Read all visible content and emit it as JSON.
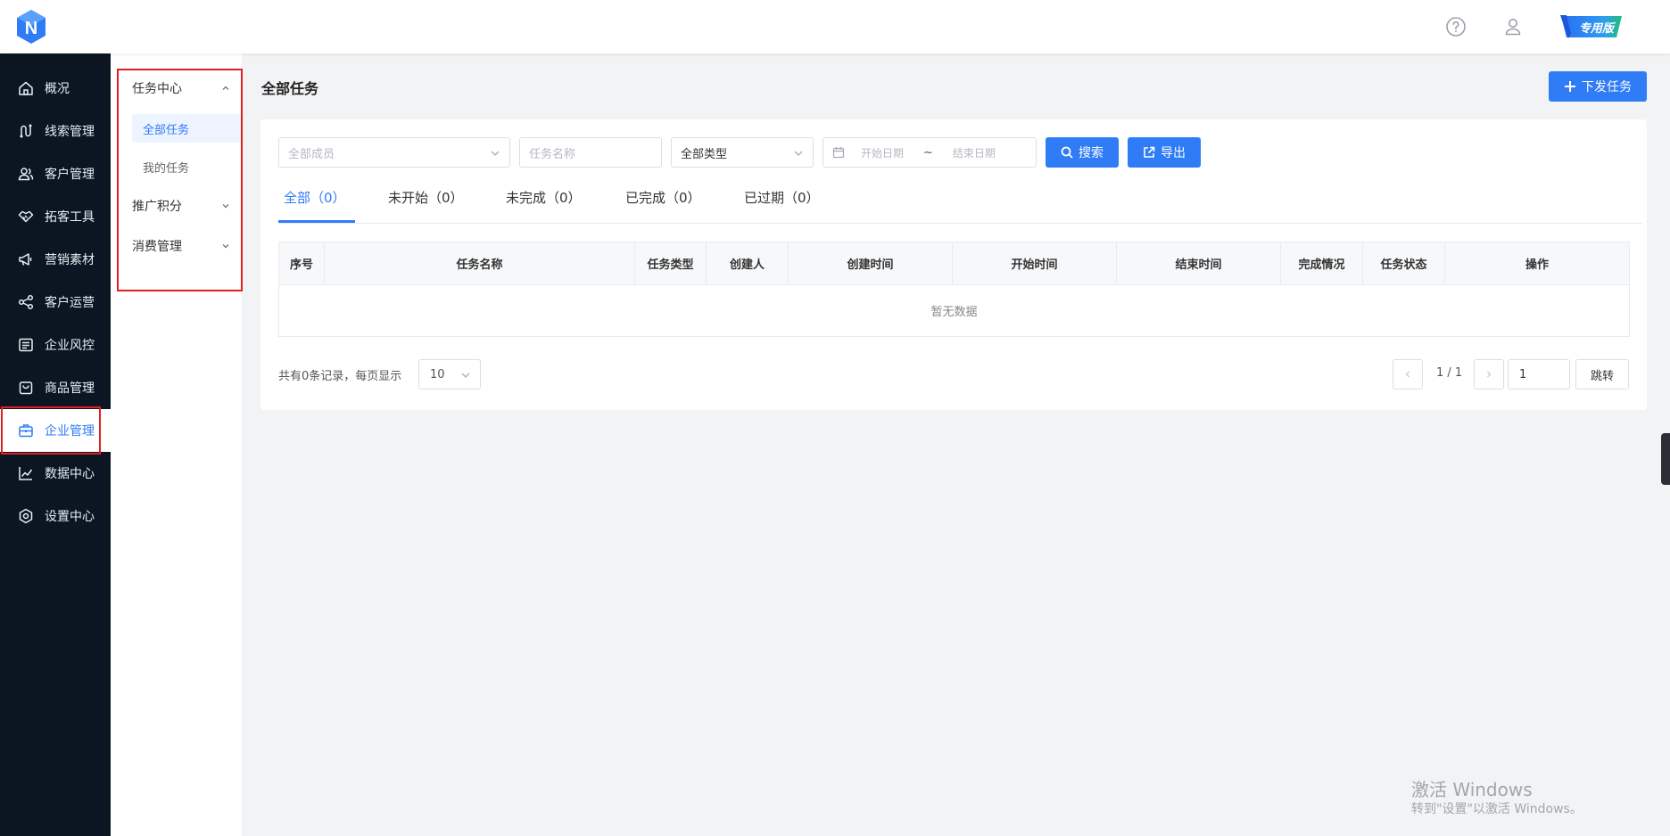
{
  "header": {
    "logo_letter": "N",
    "help_icon": "help-circle-icon",
    "user_icon": "user-icon",
    "vip_badge": "专用版",
    "brand_color": "#2f7cf6"
  },
  "sidebar": {
    "items": [
      {
        "label": "概况",
        "icon": "home-icon"
      },
      {
        "label": "线索管理",
        "icon": "route-icon"
      },
      {
        "label": "客户管理",
        "icon": "users-icon"
      },
      {
        "label": "拓客工具",
        "icon": "handshake-icon"
      },
      {
        "label": "营销素材",
        "icon": "megaphone-icon"
      },
      {
        "label": "客户运营",
        "icon": "share-icon"
      },
      {
        "label": "企业风控",
        "icon": "document-icon"
      },
      {
        "label": "商品管理",
        "icon": "bag-icon"
      },
      {
        "label": "企业管理",
        "icon": "briefcase-icon",
        "active": true
      },
      {
        "label": "数据中心",
        "icon": "chart-line-icon"
      },
      {
        "label": "设置中心",
        "icon": "settings-icon"
      }
    ]
  },
  "submenu": {
    "groups": [
      {
        "label": "任务中心",
        "expanded": true,
        "items": [
          {
            "label": "全部任务",
            "active": true
          },
          {
            "label": "我的任务"
          }
        ]
      },
      {
        "label": "推广积分",
        "expanded": false
      },
      {
        "label": "消费管理",
        "expanded": false
      }
    ]
  },
  "main": {
    "title": "全部任务",
    "publish_button": "下发任务",
    "filters": {
      "member_placeholder": "全部成员",
      "task_name_placeholder": "任务名称",
      "type_value": "全部类型",
      "start_date_placeholder": "开始日期",
      "date_separator": "~",
      "end_date_placeholder": "结束日期",
      "search_button": "搜索",
      "export_button": "导出"
    },
    "tabs": [
      {
        "label": "全部（0）",
        "active": true
      },
      {
        "label": "未开始（0）"
      },
      {
        "label": "未完成（0）"
      },
      {
        "label": "已完成（0）"
      },
      {
        "label": "已过期（0）"
      }
    ],
    "table": {
      "columns": [
        "序号",
        "任务名称",
        "任务类型",
        "创建人",
        "创建时间",
        "开始时间",
        "结束时间",
        "完成情况",
        "任务状态",
        "操作"
      ],
      "empty_text": "暂无数据"
    },
    "pagination": {
      "summary": "共有0条记录，每页显示",
      "page_size": "10",
      "page_info": "1 / 1",
      "goto_value": "1",
      "goto_button": "跳转"
    }
  },
  "watermark": {
    "line1": "激活 Windows",
    "line2": "转到\"设置\"以激活 Windows。"
  }
}
